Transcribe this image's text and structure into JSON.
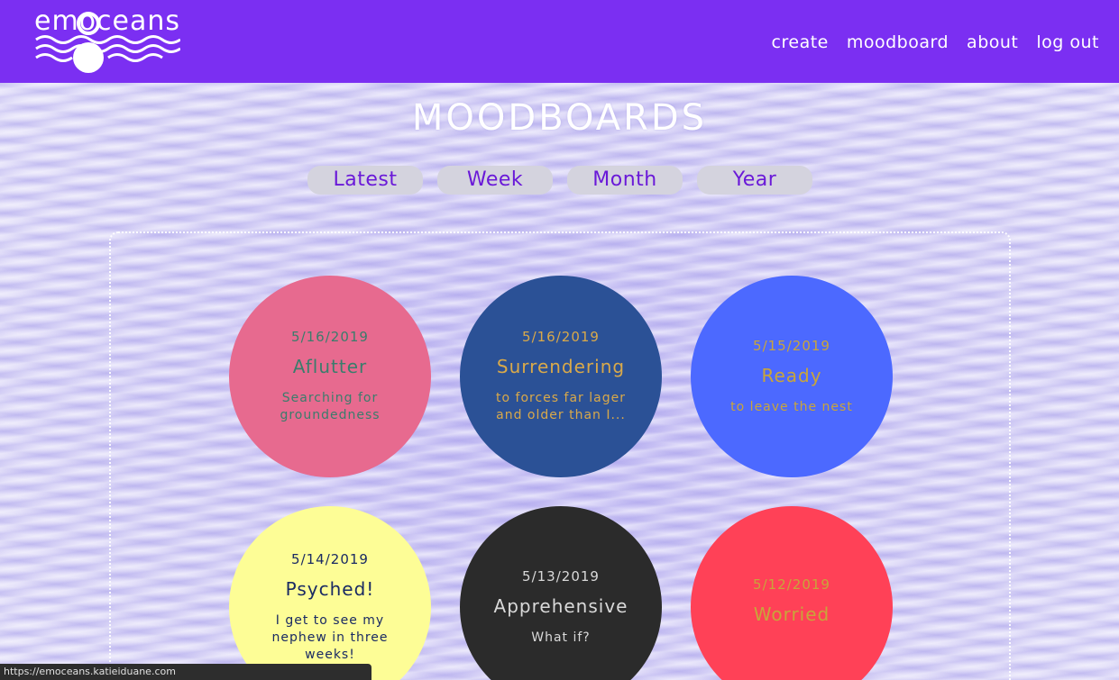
{
  "brand": {
    "logo_text": "emoceans"
  },
  "nav": {
    "items": [
      {
        "label": "create"
      },
      {
        "label": "moodboard"
      },
      {
        "label": "about"
      },
      {
        "label": "log out"
      }
    ]
  },
  "page": {
    "title": "MOODBOARDS"
  },
  "filters": {
    "tabs": [
      {
        "label": "Latest"
      },
      {
        "label": "Week"
      },
      {
        "label": "Month"
      },
      {
        "label": "Year"
      }
    ]
  },
  "moodboards": [
    {
      "date": "5/16/2019",
      "mood": "Aflutter",
      "description": "Searching for groundedness",
      "bg_color": "#e76a8f",
      "text_color": "#3a7d6c"
    },
    {
      "date": "5/16/2019",
      "mood": "Surrendering",
      "description": "to forces far lager and older than I...",
      "bg_color": "#2b5196",
      "text_color": "#d9a94a"
    },
    {
      "date": "5/15/2019",
      "mood": "Ready",
      "description": "to leave the nest",
      "bg_color": "#4c69ff",
      "text_color": "#c9a53a"
    },
    {
      "date": "5/14/2019",
      "mood": "Psyched!",
      "description": "I get to see my nephew in three weeks!",
      "bg_color": "#fdfd96",
      "text_color": "#1a2a63"
    },
    {
      "date": "5/13/2019",
      "mood": "Apprehensive",
      "description": "What if?",
      "bg_color": "#2b2b2b",
      "text_color": "#d9d9d9"
    },
    {
      "date": "5/12/2019",
      "mood": "Worried",
      "description": "",
      "bg_color": "#ff4157",
      "text_color": "#c9a53a"
    }
  ],
  "statusbar": {
    "url": "https://emoceans.katieiduane.com"
  }
}
